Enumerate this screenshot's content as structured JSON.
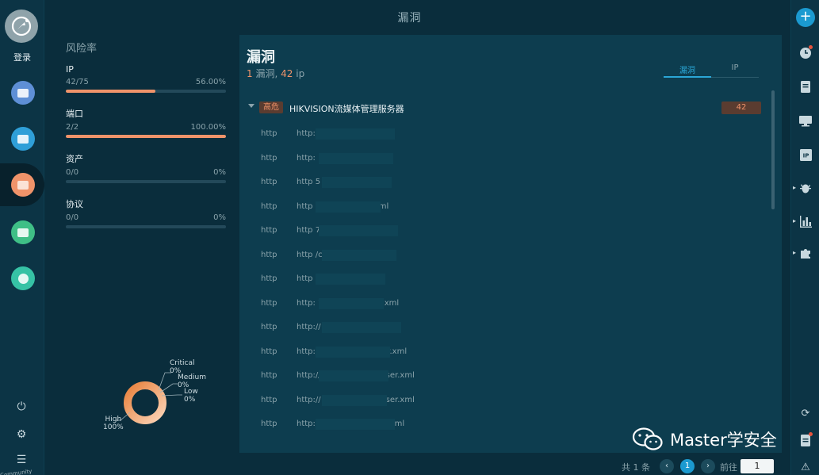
{
  "app": {
    "title": "漏洞"
  },
  "leftnav": {
    "login_label": "登录",
    "community_label": "Community"
  },
  "risk": {
    "title": "风险率",
    "stats": [
      {
        "label": "IP",
        "ratio": "42/75",
        "percent": "56.00%",
        "fill": 0.56
      },
      {
        "label": "端口",
        "ratio": "2/2",
        "percent": "100.00%",
        "fill": 1.0
      },
      {
        "label": "资产",
        "ratio": "0/0",
        "percent": "0%",
        "fill": 0
      },
      {
        "label": "协议",
        "ratio": "0/0",
        "percent": "0%",
        "fill": 0
      }
    ]
  },
  "donut": {
    "labels": [
      {
        "name": "Critical",
        "pct": "0%"
      },
      {
        "name": "Medium",
        "pct": "0%"
      },
      {
        "name": "Low",
        "pct": "0%"
      },
      {
        "name": "High",
        "pct": "100%"
      }
    ]
  },
  "main": {
    "heading": "漏洞",
    "summary": {
      "vuln_count": "1",
      "vuln_label": "漏洞,",
      "ip_count": "42",
      "ip_label": "ip"
    },
    "tabs": [
      {
        "label": "漏洞"
      },
      {
        "label": "IP"
      }
    ],
    "group": {
      "severity": "高危",
      "name": "HIKVISION流媒体管理服务器",
      "count": "42"
    },
    "rows": [
      {
        "proto": "http",
        "url": "http://1                    /config/user.xml"
      },
      {
        "proto": "http",
        "url": "http:              1          config/user.xml"
      },
      {
        "proto": "http",
        "url": "http              5           config/user.xml"
      },
      {
        "proto": "http",
        "url": "http                          88/config/user.xml"
      },
      {
        "proto": "http",
        "url": "http                          788/config/user.xml"
      },
      {
        "proto": "http",
        "url": "http                          /config/user.xml"
      },
      {
        "proto": "http",
        "url": "http                          8/config/user.xml"
      },
      {
        "proto": "http",
        "url": "http:            7            38/config/user.xml"
      },
      {
        "proto": "http",
        "url": "http://                       788/config/user.xml"
      },
      {
        "proto": "http",
        "url": "http://                       7788/config/user.xml"
      },
      {
        "proto": "http",
        "url": "http://                       9:7788/config/user.xml"
      },
      {
        "proto": "http",
        "url": "http://                       5:7788/config/user.xml"
      },
      {
        "proto": "http",
        "url": "http://1                      /88/config/user.xml"
      }
    ]
  },
  "pager": {
    "total": "共 1 条",
    "current": "1",
    "goto_label": "前往",
    "goto_value": "1"
  },
  "watermark": {
    "text": "Master学安全"
  }
}
